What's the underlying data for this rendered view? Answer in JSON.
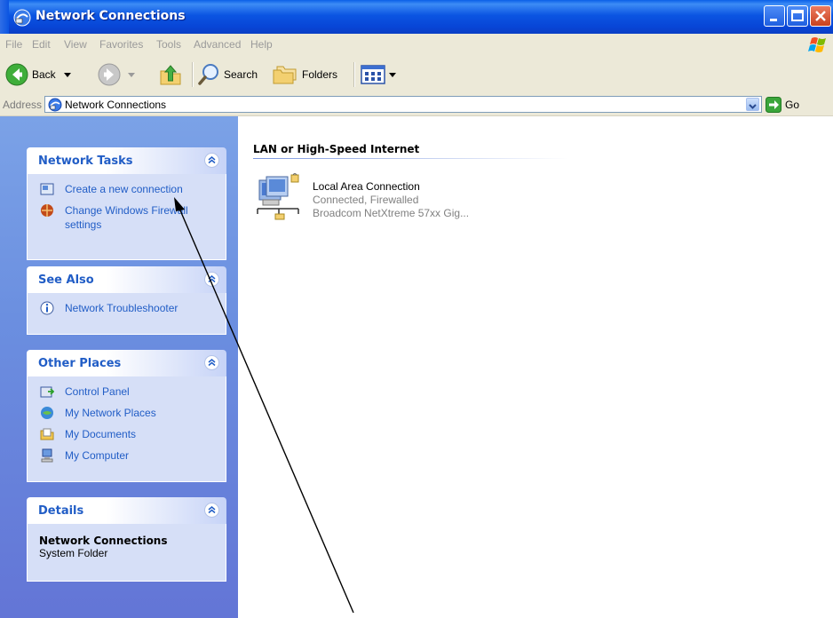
{
  "window": {
    "title": "Network Connections"
  },
  "menu": [
    "File",
    "Edit",
    "View",
    "Favorites",
    "Tools",
    "Advanced",
    "Help"
  ],
  "toolbar": {
    "back_label": "Back",
    "search_label": "Search",
    "folders_label": "Folders"
  },
  "address": {
    "label": "Address",
    "value": "Network Connections",
    "go_label": "Go"
  },
  "panels": {
    "network_tasks": {
      "title": "Network Tasks",
      "items": [
        "Create a new connection",
        "Change Windows Firewall settings"
      ]
    },
    "see_also": {
      "title": "See Also",
      "items": [
        "Network Troubleshooter"
      ]
    },
    "other_places": {
      "title": "Other Places",
      "items": [
        "Control Panel",
        "My Network Places",
        "My Documents",
        "My Computer"
      ]
    },
    "details": {
      "title": "Details",
      "name": "Network Connections",
      "type": "System Folder"
    }
  },
  "content": {
    "group_title": "LAN or High-Speed Internet",
    "connection": {
      "name": "Local Area Connection",
      "status": "Connected, Firewalled",
      "device": "Broadcom NetXtreme 57xx Gig..."
    }
  },
  "colors": {
    "titlebar": "#0b55e2",
    "task_pane": "#6b8fe0",
    "link": "#215dc6"
  }
}
